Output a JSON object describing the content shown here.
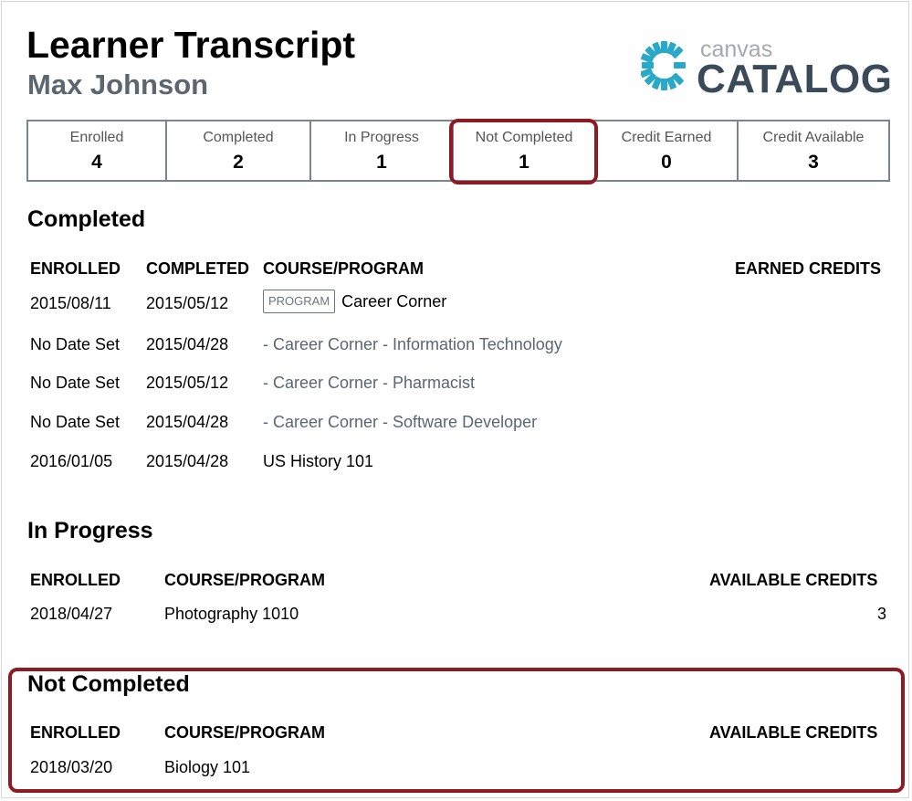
{
  "header": {
    "title": "Learner Transcript",
    "learner_name": "Max Johnson",
    "logo_small": "canvas",
    "logo_big": "CATALOG"
  },
  "stats": [
    {
      "label": "Enrolled",
      "value": "4"
    },
    {
      "label": "Completed",
      "value": "2"
    },
    {
      "label": "In Progress",
      "value": "1"
    },
    {
      "label": "Not Completed",
      "value": "1"
    },
    {
      "label": "Credit Earned",
      "value": "0"
    },
    {
      "label": "Credit Available",
      "value": "3"
    }
  ],
  "completed": {
    "title": "Completed",
    "headers": {
      "enrolled": "ENROLLED",
      "completed": "COMPLETED",
      "course": "COURSE/PROGRAM",
      "credits": "EARNED CREDITS"
    },
    "rows": [
      {
        "enrolled": "2015/08/11",
        "completed": "2015/05/12",
        "badge": "PROGRAM",
        "course": "Career Corner"
      },
      {
        "enrolled": "No Date Set",
        "completed": "2015/04/28",
        "course": "- Career Corner - Information Technology"
      },
      {
        "enrolled": "No Date Set",
        "completed": "2015/05/12",
        "course": "- Career Corner - Pharmacist"
      },
      {
        "enrolled": "No Date Set",
        "completed": "2015/04/28",
        "course": "- Career Corner - Software Developer"
      },
      {
        "enrolled": "2016/01/05",
        "completed": "2015/04/28",
        "course": "US History 101"
      }
    ]
  },
  "in_progress": {
    "title": "In Progress",
    "headers": {
      "enrolled": "ENROLLED",
      "course": "COURSE/PROGRAM",
      "credits": "AVAILABLE CREDITS"
    },
    "rows": [
      {
        "enrolled": "2018/04/27",
        "course": "Photography 1010",
        "credits": "3"
      }
    ]
  },
  "not_completed": {
    "title": "Not Completed",
    "headers": {
      "enrolled": "ENROLLED",
      "course": "COURSE/PROGRAM",
      "credits": "AVAILABLE CREDITS"
    },
    "rows": [
      {
        "enrolled": "2018/03/20",
        "course": "Biology 101"
      }
    ]
  },
  "colors": {
    "highlight": "#8e1b21",
    "logo_accent": "#29a9c7",
    "logo_text": "#3b4a58",
    "muted_text": "#5b6670"
  },
  "icons": {
    "logo_mark": "canvas-catalog-logo-icon"
  }
}
